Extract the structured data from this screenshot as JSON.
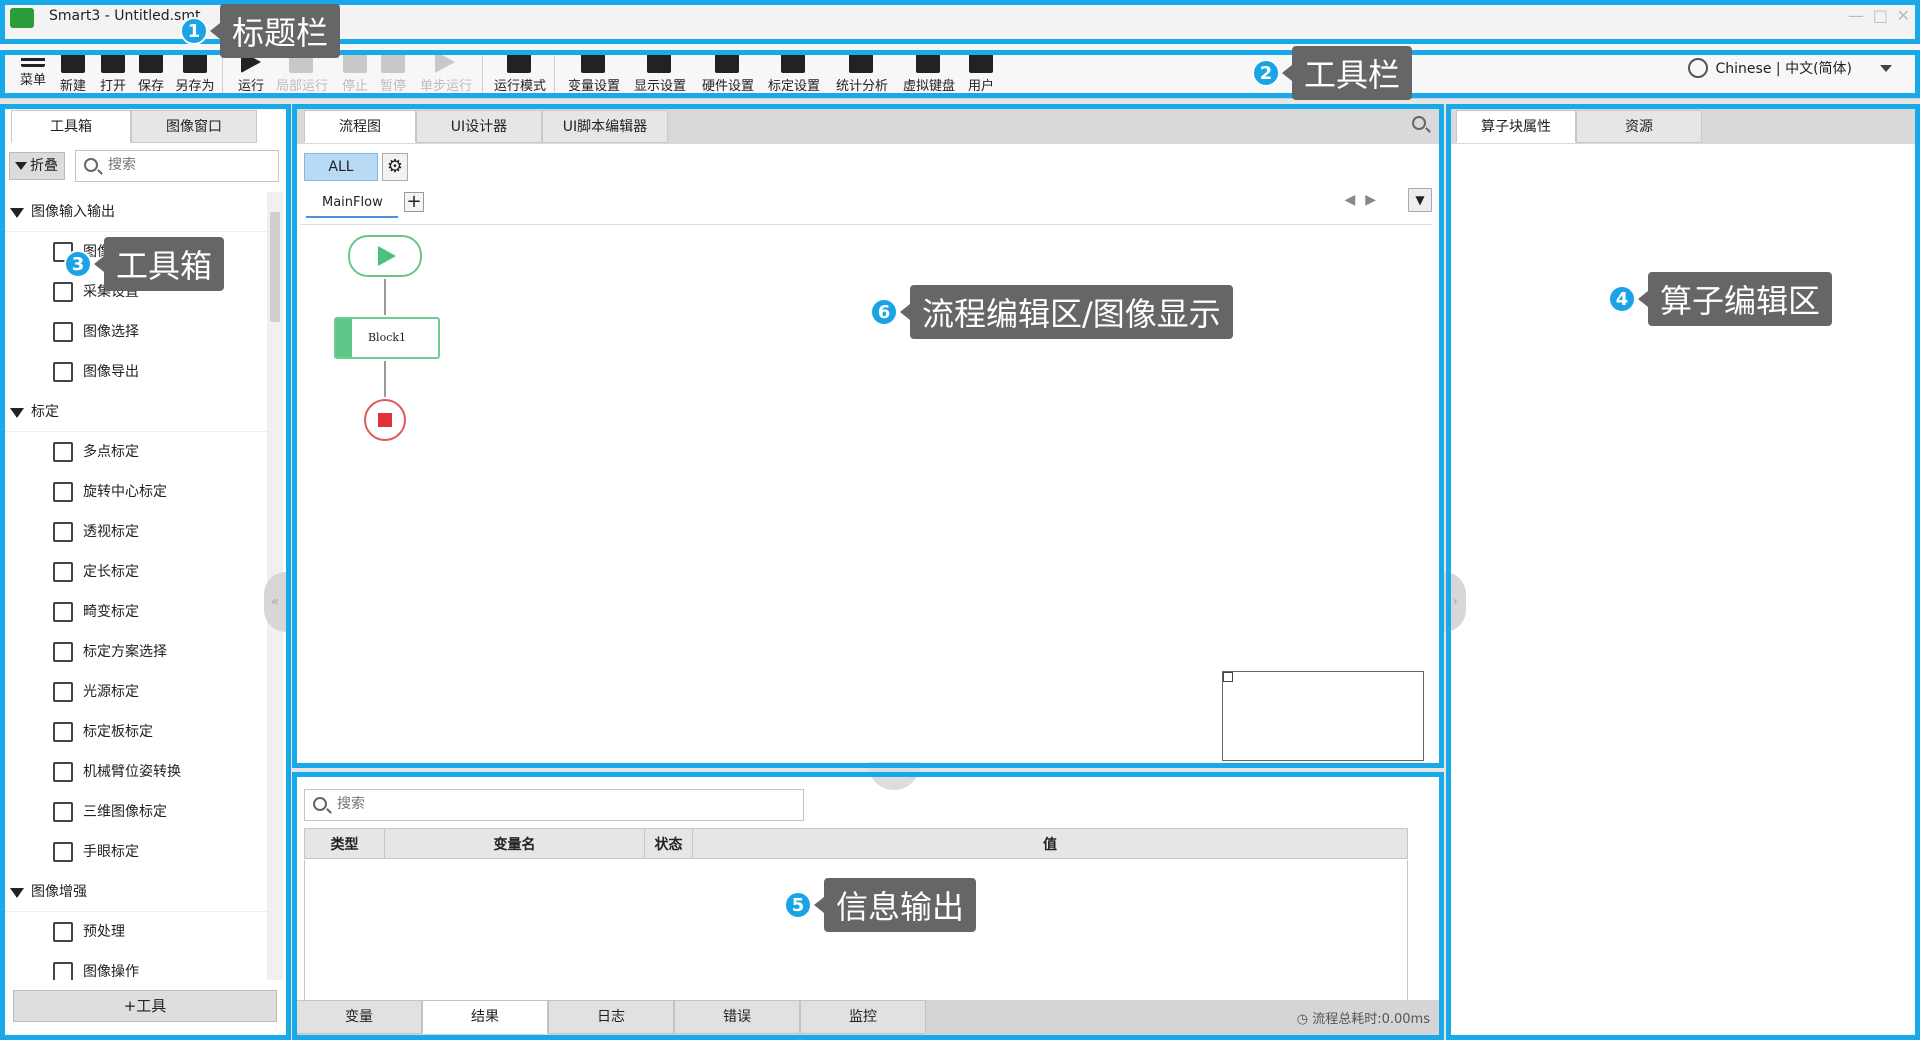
{
  "window": {
    "title": "Smart3 - Untitled.smt",
    "controls": [
      "—",
      "□",
      "✕"
    ]
  },
  "toolbar": {
    "buttons": [
      {
        "label": "菜单",
        "icon": "menu-icon",
        "enabled": true
      },
      {
        "label": "新建",
        "icon": "new-file-icon",
        "enabled": true
      },
      {
        "label": "打开",
        "icon": "folder-open-icon",
        "enabled": true
      },
      {
        "label": "保存",
        "icon": "save-icon",
        "enabled": true
      },
      {
        "label": "另存为",
        "icon": "save-as-icon",
        "enabled": true
      },
      {
        "label": "运行",
        "icon": "play-icon",
        "enabled": true
      },
      {
        "label": "局部运行",
        "icon": "partial-run-icon",
        "enabled": false
      },
      {
        "label": "停止",
        "icon": "stop-icon",
        "enabled": false
      },
      {
        "label": "暂停",
        "icon": "pause-icon",
        "enabled": false
      },
      {
        "label": "单步运行",
        "icon": "step-run-icon",
        "enabled": false
      },
      {
        "label": "运行模式",
        "icon": "run-mode-icon",
        "enabled": true
      },
      {
        "label": "变量设置",
        "icon": "variable-settings-icon",
        "enabled": true
      },
      {
        "label": "显示设置",
        "icon": "display-settings-icon",
        "enabled": true
      },
      {
        "label": "硬件设置",
        "icon": "hardware-settings-icon",
        "enabled": true
      },
      {
        "label": "标定设置",
        "icon": "calibration-settings-icon",
        "enabled": true
      },
      {
        "label": "统计分析",
        "icon": "statistics-icon",
        "enabled": true
      },
      {
        "label": "虚拟键盘",
        "icon": "keyboard-icon",
        "enabled": true
      },
      {
        "label": "用户",
        "icon": "user-icon",
        "enabled": true
      }
    ],
    "language": "Chinese | 中文(简体)"
  },
  "toolbox": {
    "tabs": [
      "工具箱",
      "图像窗口"
    ],
    "collapse_label": "折叠",
    "search_placeholder": "搜索",
    "categories": [
      {
        "name": "图像输入输出",
        "items": [
          "图像导入",
          "采集设置",
          "图像选择",
          "图像导出"
        ]
      },
      {
        "name": "标定",
        "items": [
          "多点标定",
          "旋转中心标定",
          "透视标定",
          "定长标定",
          "畸变标定",
          "标定方案选择",
          "光源标定",
          "标定板标定",
          "机械臂位姿转换",
          "三维图像标定",
          "手眼标定"
        ]
      },
      {
        "name": "图像增强",
        "items": [
          "预处理",
          "图像操作"
        ]
      }
    ],
    "add_tool_label": "+工具"
  },
  "flow": {
    "tabs": [
      "流程图",
      "UI设计器",
      "UI脚本编辑器"
    ],
    "filter_label": "ALL",
    "flow_tab": "MainFlow",
    "add_label": "+",
    "block_label": "Block1"
  },
  "info": {
    "search_placeholder": "搜索",
    "columns": [
      "类型",
      "变量名",
      "状态",
      "值"
    ],
    "bottom_tabs": [
      "变量",
      "结果",
      "日志",
      "错误",
      "监控"
    ],
    "timer": "流程总耗时:0.00ms"
  },
  "props": {
    "tabs": [
      "算子块属性",
      "资源"
    ]
  },
  "annotations": [
    {
      "num": "1",
      "label": "标题栏"
    },
    {
      "num": "2",
      "label": "工具栏"
    },
    {
      "num": "3",
      "label": "工具箱"
    },
    {
      "num": "4",
      "label": "算子编辑区"
    },
    {
      "num": "5",
      "label": "信息输出"
    },
    {
      "num": "6",
      "label": "流程编辑区/图像显示"
    }
  ],
  "colors": {
    "highlight": "#19a8e8",
    "callout_bg": "#666666"
  }
}
